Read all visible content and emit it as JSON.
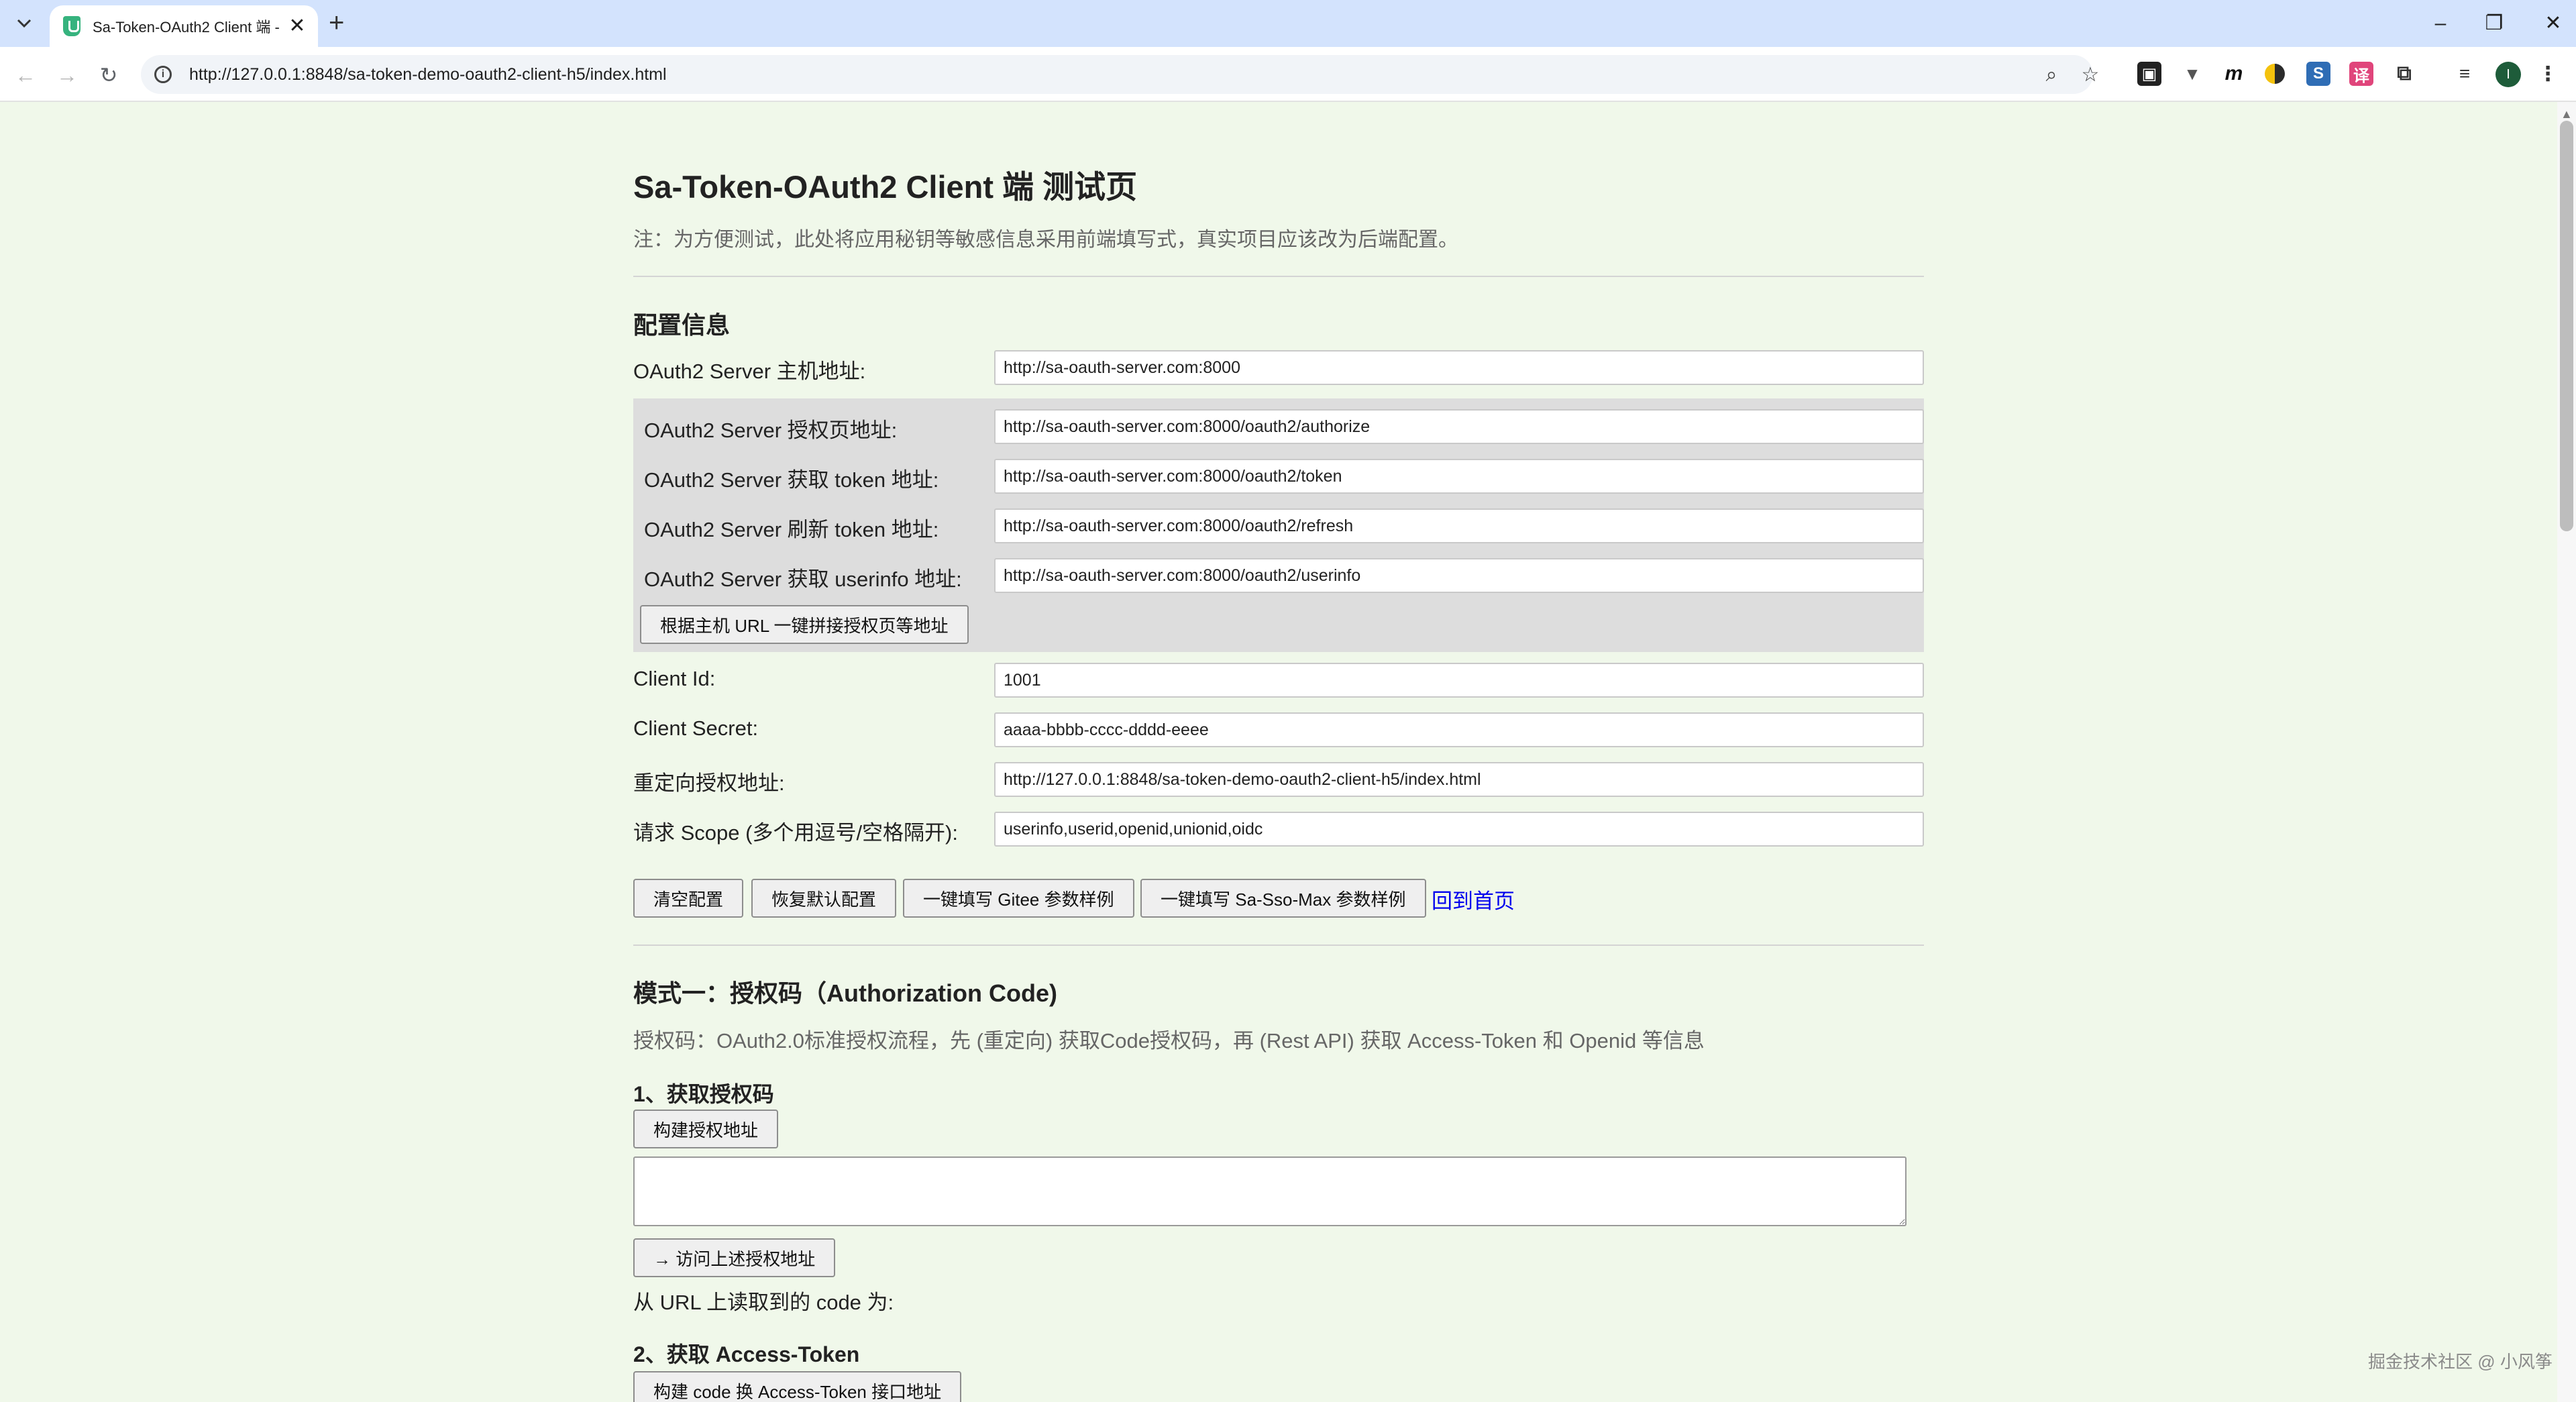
{
  "browser": {
    "tab_title": "Sa-Token-OAuth2 Client 端 -",
    "tab_close": "✕",
    "new_tab": "+",
    "url": "http://127.0.0.1:8848/sa-token-demo-oauth2-client-h5/index.html",
    "avatar_letter": "I",
    "ext_m": "m"
  },
  "page": {
    "title": "Sa-Token-OAuth2 Client 端 测试页",
    "note": "注：为方便测试，此处将应用秘钥等敏感信息采用前端填写式，真实项目应该改为后端配置。",
    "config_heading": "配置信息",
    "server_host_label": "OAuth2 Server 主机地址:",
    "server_host_value": "http://sa-oauth-server.com:8000",
    "authorize_label": "OAuth2 Server 授权页地址:",
    "authorize_value": "http://sa-oauth-server.com:8000/oauth2/authorize",
    "token_label": "OAuth2 Server 获取 token 地址:",
    "token_value": "http://sa-oauth-server.com:8000/oauth2/token",
    "refresh_label": "OAuth2 Server 刷新 token 地址:",
    "refresh_value": "http://sa-oauth-server.com:8000/oauth2/refresh",
    "userinfo_label": "OAuth2 Server 获取 userinfo 地址:",
    "userinfo_value": "http://sa-oauth-server.com:8000/oauth2/userinfo",
    "build_urls_button": "根据主机 URL 一键拼接授权页等地址",
    "client_id_label": "Client Id:",
    "client_id_value": "1001",
    "client_secret_label": "Client Secret:",
    "client_secret_value": "aaaa-bbbb-cccc-dddd-eeee",
    "redirect_label": "重定向授权地址:",
    "redirect_value": "http://127.0.0.1:8848/sa-token-demo-oauth2-client-h5/index.html",
    "scope_label": "请求 Scope (多个用逗号/空格隔开):",
    "scope_value": "userinfo,userid,openid,unionid,oidc",
    "btn_clear": "清空配置",
    "btn_restore": "恢复默认配置",
    "btn_gitee": "一键填写 Gitee 参数样例",
    "btn_sso_max": "一键填写 Sa-Sso-Max 参数样例",
    "link_home": "回到首页",
    "mode1_heading": "模式一：授权码（Authorization Code)",
    "mode1_desc": "授权码：OAuth2.0标准授权流程，先 (重定向) 获取Code授权码，再 (Rest API) 获取 Access-Token 和 Openid 等信息",
    "step1_heading": "1、获取授权码",
    "btn_build_auth": "构建授权地址",
    "btn_visit_auth": "→ 访问上述授权地址",
    "code_read_label": "从 URL 上读取到的 code 为:",
    "step2_heading": "2、获取 Access-Token",
    "btn_build_token": "构建 code 换 Access-Token 接口地址"
  },
  "watermark": "掘金技术社区 @ 小风筝"
}
